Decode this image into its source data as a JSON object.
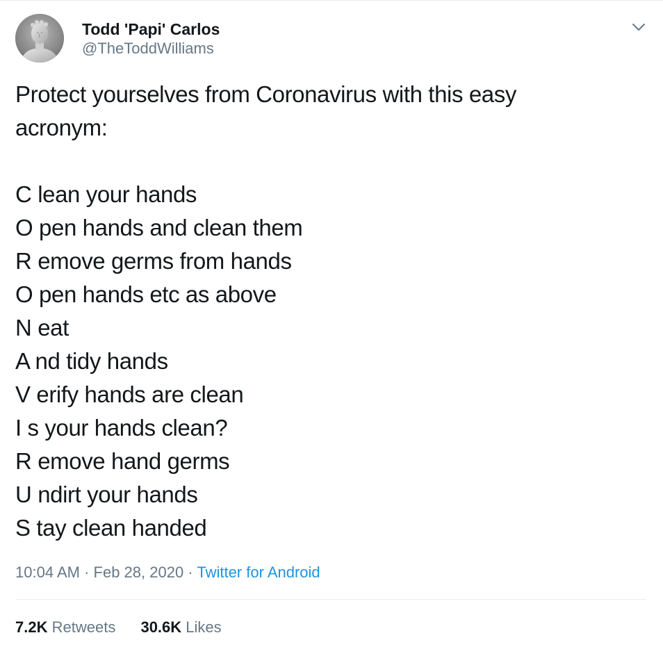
{
  "user": {
    "display_name": "Todd 'Papi' Carlos",
    "handle": "@TheToddWilliams",
    "avatar_icon": "statue-bust-avatar"
  },
  "tweet": {
    "intro_lines": [
      "Protect yourselves from Coronavirus with this easy",
      "acronym:"
    ],
    "acronym_lines": [
      "C lean your hands",
      "O pen hands and clean them",
      "R emove germs from hands",
      "O pen hands etc as above",
      "N eat",
      "A nd tidy hands",
      "V erify hands are clean",
      "I s your hands clean?",
      "R emove hand germs",
      "U ndirt your hands",
      "S tay clean handed"
    ]
  },
  "meta": {
    "time": "10:04 AM",
    "sep1": " · ",
    "date": "Feb 28, 2020",
    "sep2": " · ",
    "source": "Twitter for Android"
  },
  "stats": {
    "retweets_count": "7.2K",
    "retweets_label": "Retweets",
    "likes_count": "30.6K",
    "likes_label": "Likes"
  },
  "colors": {
    "text": "#14171a",
    "secondary": "#657786",
    "link": "#1b95e0",
    "divider": "#e6ecf0"
  }
}
